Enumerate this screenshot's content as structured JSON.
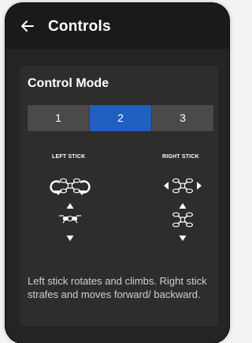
{
  "header": {
    "title": "Controls"
  },
  "control_mode": {
    "title": "Control Mode",
    "options": [
      "1",
      "2",
      "3"
    ],
    "selected": "2"
  },
  "left_stick": {
    "label": "LEFT STICK"
  },
  "right_stick": {
    "label": "RIGHT STICK"
  },
  "description": "Left stick rotates and climbs. Right stick strafes and moves forward/ backward.",
  "colors": {
    "accent": "#1f5fbf",
    "background": "#242424",
    "card": "#2d2d2d"
  }
}
